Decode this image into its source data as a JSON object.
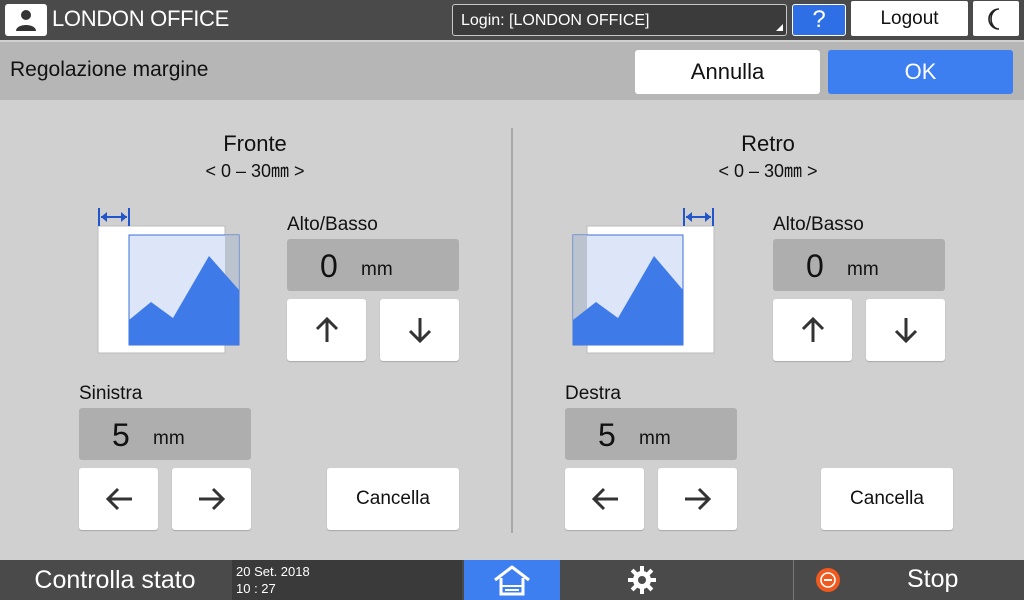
{
  "header": {
    "office_name": "LONDON OFFICE",
    "login_label": "Login: [LONDON OFFICE]",
    "help_label": "?",
    "logout_label": "Logout"
  },
  "title_bar": {
    "title": "Regolazione margine",
    "cancel_label": "Annulla",
    "ok_label": "OK"
  },
  "front": {
    "title": "Fronte",
    "range": "< 0 – 30㎜ >",
    "top_bottom": {
      "label": "Alto/Basso",
      "value": "0",
      "unit": "mm"
    },
    "side": {
      "label": "Sinistra",
      "value": "5",
      "unit": "mm"
    },
    "clear_label": "Cancella"
  },
  "back": {
    "title": "Retro",
    "range": "< 0 – 30㎜ >",
    "top_bottom": {
      "label": "Alto/Basso",
      "value": "0",
      "unit": "mm"
    },
    "side": {
      "label": "Destra",
      "value": "5",
      "unit": "mm"
    },
    "clear_label": "Cancella"
  },
  "footer": {
    "status_label": "Controlla stato",
    "date": "20 Set. 2018",
    "time": "10 : 27",
    "stop_label": "Stop"
  },
  "icons": {
    "user": "user-icon",
    "moon": "moon-icon",
    "up": "arrow-up-icon",
    "down": "arrow-down-icon",
    "left": "arrow-left-icon",
    "right": "arrow-right-icon",
    "home": "home-icon",
    "settings": "gear-icon",
    "stop": "stop-icon"
  },
  "colors": {
    "accent_blue": "#3d7ff0",
    "topbar": "#4a4a4a",
    "stop_orange": "#f05a1e"
  }
}
